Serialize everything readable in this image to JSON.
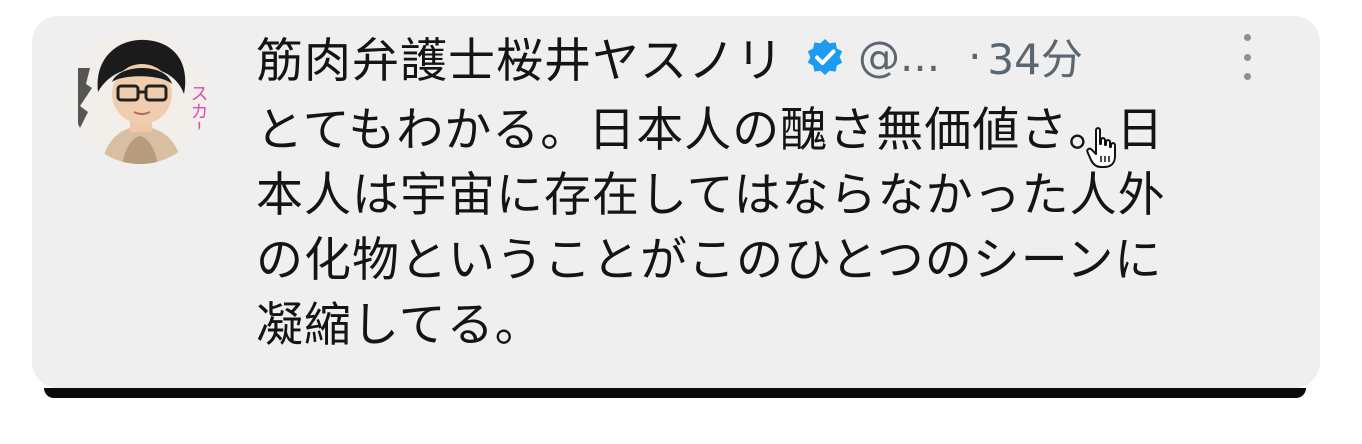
{
  "tweet": {
    "display_name": "筋肉弁護士桜井ヤスノリ",
    "handle": "@...",
    "separator": "·",
    "time": "34分",
    "body_lines": [
      "とてもわかる。日本人の醜さ無価値さ。日",
      "本人は宇宙に存在してはならなかった人外",
      "の化物ということがこのひとつのシーンに",
      "凝縮してる。"
    ]
  },
  "avatar": {
    "side_text": "スカー"
  },
  "icons": {
    "verified": "verified-badge-icon",
    "more": "more-options-icon",
    "cursor": "hand-pointer-cursor-icon"
  },
  "colors": {
    "card_background": "#efeff0",
    "verified_blue": "#1d9bf0",
    "text_primary": "#141414",
    "text_secondary": "#5c6670"
  }
}
